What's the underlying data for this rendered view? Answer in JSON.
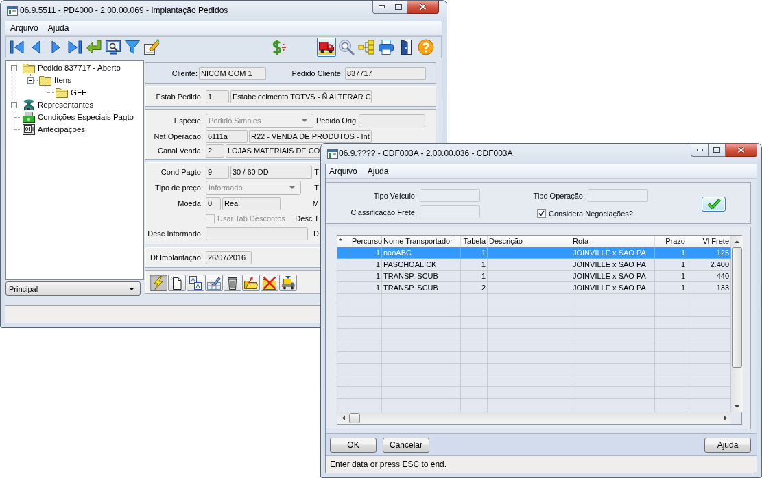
{
  "main_window": {
    "title": "06.9.5511 - PD4000 - 2.00.00.069 - Implantação Pedidos",
    "menu": [
      {
        "label": "Arquivo"
      },
      {
        "label": "Ajuda"
      }
    ],
    "toolbar": [
      [
        {
          "kind": "first",
          "pressed": false
        },
        {
          "kind": "previous",
          "pressed": false
        },
        {
          "kind": "next",
          "pressed": false
        },
        {
          "kind": "last",
          "pressed": false
        },
        {
          "kind": "return",
          "pressed": false
        },
        {
          "kind": "preview",
          "pressed": false
        },
        {
          "kind": "filter",
          "pressed": false
        },
        {
          "kind": "edit",
          "pressed": false
        }
      ],
      [
        {
          "kind": "money",
          "pressed": false
        }
      ],
      [
        {
          "kind": "freight",
          "pressed": true
        },
        {
          "kind": "zoom",
          "pressed": false
        },
        {
          "kind": "structure",
          "pressed": false
        },
        {
          "kind": "print",
          "pressed": false
        },
        {
          "kind": "exit",
          "pressed": false
        },
        {
          "kind": "help",
          "pressed": false
        }
      ]
    ],
    "tree": [
      {
        "label": "Pedido 837717 - Aberto",
        "kind": "folder",
        "expanded": true,
        "children": [
          {
            "label": "Itens",
            "kind": "folder",
            "expanded": true,
            "children": [
              {
                "label": "GFE",
                "kind": "folder"
              }
            ]
          }
        ]
      },
      {
        "label": "Representantes",
        "kind": "people",
        "expanded": false
      },
      {
        "label": "Condições Especiais Pagto",
        "kind": "money"
      },
      {
        "label": "Antecipações",
        "kind": "safe"
      }
    ],
    "view_select": {
      "value": "Principal"
    },
    "sections": [
      {
        "rows": [
          [
            {
              "kind": "label",
              "text": "Cliente:"
            },
            {
              "kind": "field",
              "value": "NICOM COM 1"
            },
            {
              "kind": "label",
              "text": "Pedido Cliente:"
            },
            {
              "kind": "field",
              "value": "837717"
            }
          ]
        ]
      },
      {
        "rows": [
          [
            {
              "kind": "label",
              "text": "Estab Pedido:"
            },
            {
              "kind": "field",
              "value": "1"
            },
            {
              "kind": "field",
              "value": "Estabelecimento TOTVS - Ñ ALTERAR C"
            }
          ]
        ]
      },
      {
        "rows": [
          [
            {
              "kind": "label",
              "text": "Espécie:"
            },
            {
              "kind": "combo",
              "value": "Pedido Simples",
              "disabled": true
            },
            {
              "kind": "label",
              "text": "Pedido Orig:"
            },
            {
              "kind": "field"
            }
          ],
          [
            {
              "kind": "label",
              "text": "Nat Operação:"
            },
            {
              "kind": "field",
              "value": "6111a"
            },
            {
              "kind": "field",
              "value": "R22 - VENDA DE PRODUTOS - Int"
            }
          ],
          [
            {
              "kind": "label",
              "text": "Canal Venda:"
            },
            {
              "kind": "field",
              "value": "2"
            },
            {
              "kind": "field",
              "value": "LOJAS MATERIAIS DE CO"
            }
          ]
        ]
      },
      {
        "rows": [
          [
            {
              "kind": "label",
              "text": "Cond Pagto:"
            },
            {
              "kind": "field",
              "value": "9"
            },
            {
              "kind": "field",
              "value": "30 / 60 DD"
            },
            {
              "kind": "label",
              "text": "T"
            }
          ],
          [
            {
              "kind": "label",
              "text": "Tipo de preço:"
            },
            {
              "kind": "combo",
              "value": "Informado",
              "disabled": true
            },
            {
              "kind": "label",
              "text": "T"
            }
          ],
          [
            {
              "kind": "label",
              "text": "Moeda:"
            },
            {
              "kind": "field",
              "value": "0"
            },
            {
              "kind": "field",
              "value": "Real"
            },
            {
              "kind": "label",
              "text": "M"
            }
          ],
          [
            null,
            {
              "kind": "checkbox",
              "label": "Usar Tab Descontos",
              "checked": false,
              "disabled": true
            },
            null,
            {
              "kind": "label",
              "text": "Desc T"
            }
          ],
          [
            {
              "kind": "label",
              "text": "Desc Informado:"
            },
            {
              "kind": "field"
            },
            {
              "kind": "label",
              "text": "D"
            }
          ]
        ]
      },
      {
        "rows": [
          [
            {
              "kind": "label",
              "text": "Dt Implantação:"
            },
            {
              "kind": "field",
              "value": "26/07/2016"
            }
          ]
        ]
      }
    ],
    "actions": [
      {
        "kind": "execute",
        "pressed": true
      },
      {
        "kind": "new",
        "pressed": false
      },
      {
        "kind": "translate",
        "pressed": false
      },
      {
        "kind": "edit",
        "pressed": false
      },
      {
        "kind": "delete",
        "pressed": false
      },
      {
        "kind": "open",
        "pressed": false
      },
      {
        "kind": "cancel",
        "pressed": false
      },
      {
        "kind": "load",
        "pressed": false
      }
    ]
  },
  "dialog": {
    "title": "06.9.???? - CDF003A - 2.00.00.036 - CDF003A",
    "menu": [
      {
        "label": "Arquivo"
      },
      {
        "label": "Ajuda"
      }
    ],
    "filters": [
      {
        "kind": "field",
        "label": "Tipo Veículo:"
      },
      {
        "kind": "field",
        "label": "Classificação Frete:"
      },
      {
        "kind": "field",
        "label": "Tipo Operação:"
      },
      {
        "kind": "checkbox",
        "label": "Considera Negociações?",
        "checked": true
      }
    ],
    "table": {
      "columns": [
        "*",
        "Percurso",
        "Nome Transportador",
        "Tabela",
        "Descrição",
        "Rota",
        "Prazo",
        "Vl Frete"
      ],
      "rows": [
        {
          "cells": [
            null,
            "1",
            "naoABC",
            "1",
            null,
            "JOINVILLE x SAO PA",
            "1",
            "125"
          ],
          "selected": true
        },
        {
          "cells": [
            null,
            "1",
            "PASCHOALICK",
            "1",
            null,
            "JOINVILLE x SAO PA",
            "1",
            "2.400"
          ],
          "selected": false
        },
        {
          "cells": [
            null,
            "1",
            "TRANSP. SCUB",
            "1",
            null,
            "JOINVILLE x SAO PA",
            "1",
            "440"
          ],
          "selected": false
        },
        {
          "cells": [
            null,
            "1",
            "TRANSP. SCUB",
            "2",
            null,
            "JOINVILLE x SAO PA",
            "1",
            "133"
          ],
          "selected": false
        }
      ]
    },
    "buttons": [
      {
        "label": "OK"
      },
      {
        "label": "Cancelar"
      },
      {
        "label": "Ajuda"
      }
    ],
    "status_bar": "Enter data or press ESC to end."
  }
}
